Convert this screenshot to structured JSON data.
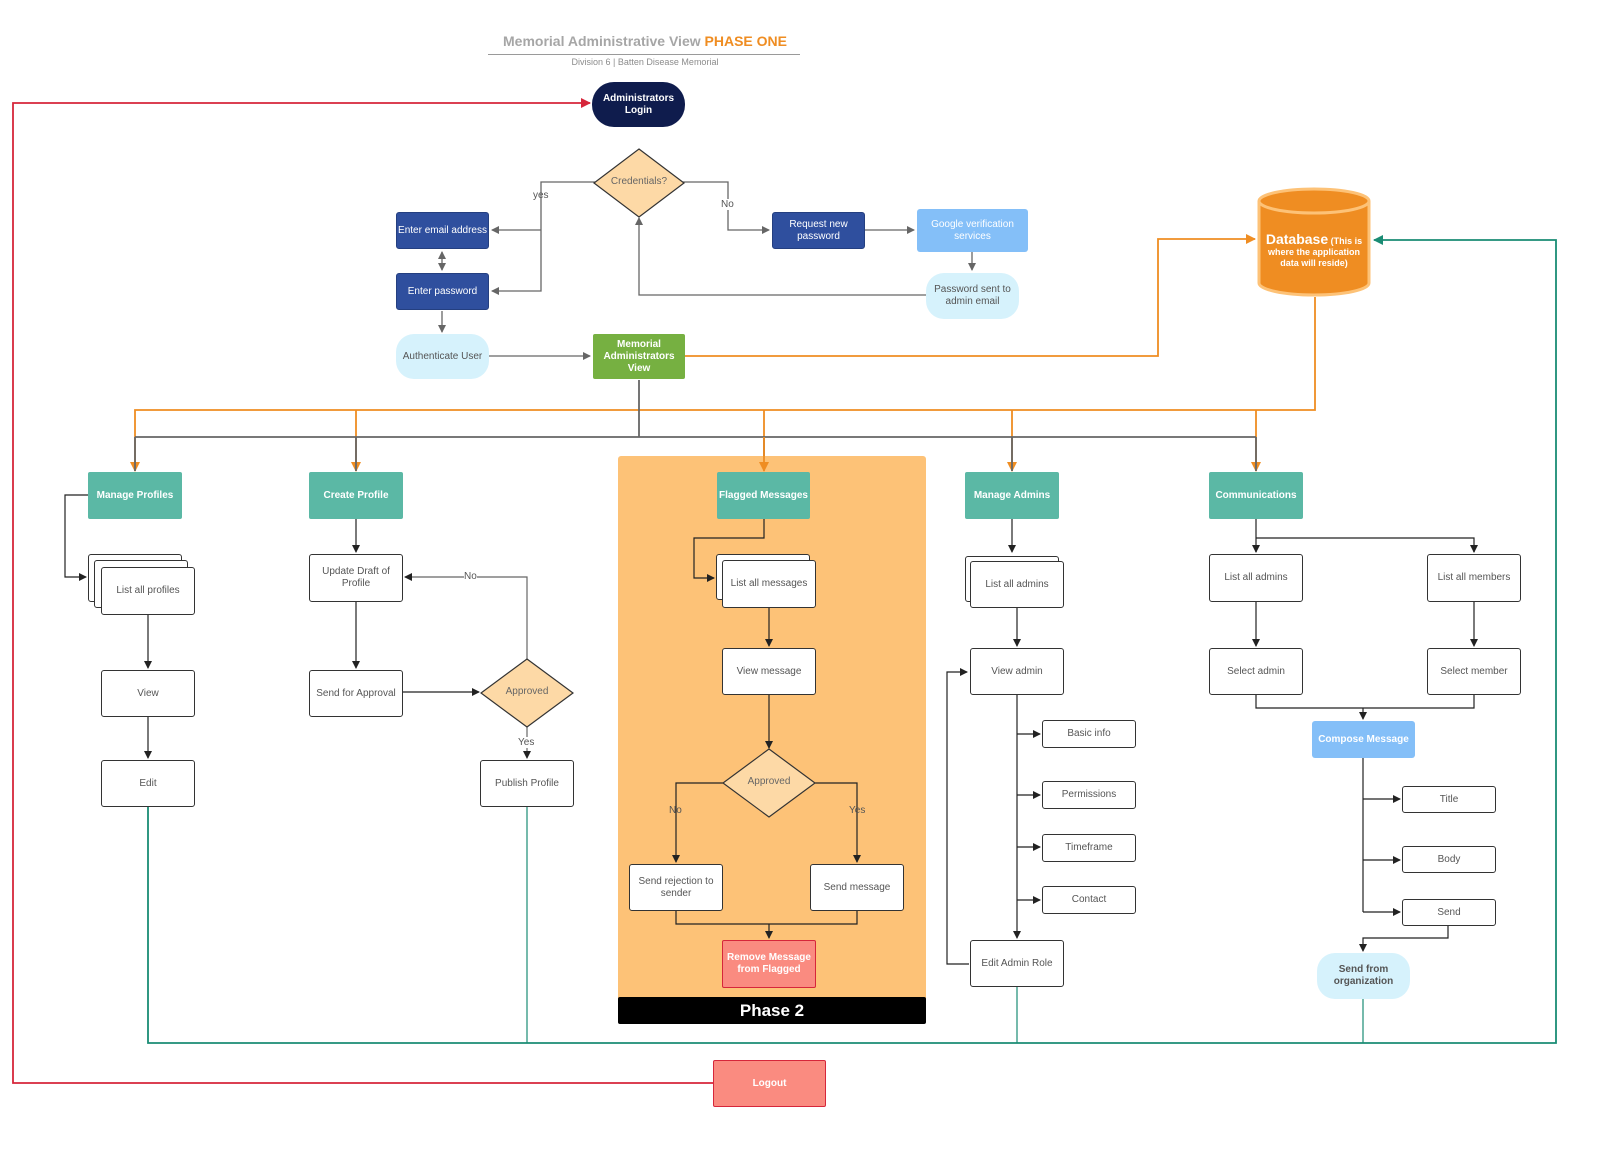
{
  "header": {
    "title": "Memorial Administrative View",
    "title_accent": "PHASE ONE",
    "subtitle": "Division 6 | Batten Disease Memorial"
  },
  "colors": {
    "navy": "#0f1c4d",
    "dark_blue": "#2f4f9e",
    "light_blue": "#84bff8",
    "pale_blue": "#d6f2fc",
    "green": "#76b041",
    "teal": "#5bb8a5",
    "decision": "#fdd9a6",
    "database": "#ef8d22",
    "phase2_bg": "#fdc277",
    "logout": "#fa8b80",
    "orange_line": "#ef8d22",
    "teal_line": "#1a8c74",
    "red_line": "#d6263a"
  },
  "login": {
    "admin_login": "Administrators Login",
    "credentials": "Credentials?",
    "yes_label": "yes",
    "no_label": "No",
    "enter_email": "Enter email address",
    "enter_password": "Enter password",
    "authenticate": "Authenticate User",
    "request_password": "Request new password",
    "google_verification": "Google verification services",
    "password_sent": "Password sent to admin email",
    "admin_view": "Memorial Administrators View"
  },
  "database": {
    "title": "Database",
    "note": "(This is where the application data will reside)"
  },
  "manage_profiles": {
    "title": "Manage Profiles",
    "list": "List all profiles",
    "view": "View",
    "edit": "Edit"
  },
  "create_profile": {
    "title": "Create Profile",
    "update_draft": "Update Draft of Profile",
    "send_approval": "Send for Approval",
    "approved": "Approved",
    "no_label": "No",
    "yes_label": "Yes",
    "publish": "Publish Profile"
  },
  "flagged": {
    "title": "Flagged Messages",
    "list": "List all messages",
    "view": "View message",
    "approved": "Approved",
    "no_label": "No",
    "yes_label": "Yes",
    "rejection": "Send rejection to sender",
    "send": "Send message",
    "remove": "Remove Message from Flagged",
    "phase_label": "Phase 2"
  },
  "manage_admins": {
    "title": "Manage Admins",
    "list": "List all admins",
    "view": "View admin",
    "basic_info": "Basic info",
    "permissions": "Permissions",
    "timeframe": "Timeframe",
    "contact": "Contact",
    "edit_role": "Edit Admin Role"
  },
  "communications": {
    "title": "Communications",
    "list_admins": "List all admins",
    "list_members": "List all members",
    "select_admin": "Select admin",
    "select_member": "Select member",
    "compose": "Compose Message",
    "field_title": "Title",
    "field_body": "Body",
    "field_send": "Send",
    "send_org": "Send from organization"
  },
  "logout": "Logout"
}
